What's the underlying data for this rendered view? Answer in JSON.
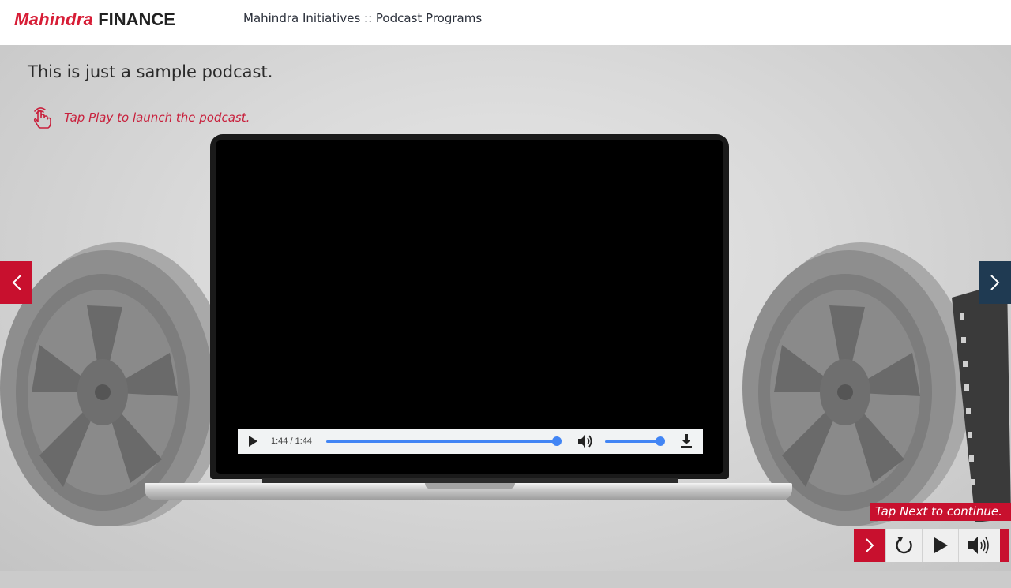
{
  "header": {
    "logo_primary": "Mahindra",
    "logo_secondary": "FINANCE",
    "title": "Mahindra Initiatives :: Podcast Programs"
  },
  "content": {
    "sample_text": "This is just a sample podcast.",
    "hint_text": "Tap Play to launch the podcast.",
    "hint_icon": "tap-hand-icon"
  },
  "player": {
    "time": "1:44 / 1:44",
    "progress": 1.0,
    "volume": 1.0
  },
  "controls": {
    "tap_next_text": "Tap Next to continue.",
    "icons": [
      "chevron-right-icon",
      "replay-icon",
      "play-icon",
      "volume-icon"
    ]
  },
  "colors": {
    "brand_red": "#c8102e",
    "nav_navy": "#1f3a52",
    "player_accent": "#4285f4"
  }
}
